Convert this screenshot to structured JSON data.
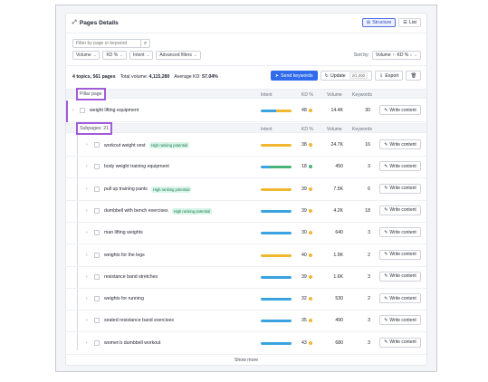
{
  "header": {
    "title": "Pages Details",
    "view_structure": "Structure",
    "view_list": "List"
  },
  "search": {
    "placeholder": "Filter by page or keyword"
  },
  "filters": [
    "Volume",
    "KD %",
    "Intent",
    "Advanced filters"
  ],
  "sort": {
    "label": "Sort by:",
    "value": "Volume ↑· KD % ↓"
  },
  "summary": {
    "topics": "4 topics, 561 pages",
    "volume_label": "Total volume:",
    "volume_value": "4,115,280",
    "kd_label": "Average KD:",
    "kd_value": "57.04%"
  },
  "actions": {
    "send": "Send keywords",
    "update": "Update",
    "update_limit": "2/1,000",
    "export": "Export"
  },
  "columns": {
    "intent": "Intent",
    "kd": "KD %",
    "volume": "Volume",
    "keywords": "Keywords"
  },
  "pillar_label": "Pillar page",
  "subpages_label": "Subpages: 21",
  "write_content": "Write content",
  "show_more": "Show more",
  "colors": {
    "accent": "#2f6bea",
    "highlight": "#a15ad9",
    "easy": "#4ab37a",
    "medium": "#f1b731",
    "info": "#3aa3e0"
  },
  "pillar": {
    "name": "weight lifting equipment",
    "kd": "48",
    "kd_color": "#f1b731",
    "volume": "14.4K",
    "keywords": "30",
    "intent": [
      {
        "c": "#3aa3e0",
        "w": 0.5
      },
      {
        "c": "#f1b731",
        "w": 0.5
      }
    ]
  },
  "subpages": [
    {
      "name": "workout weight vest",
      "badge": "High ranking potential",
      "kd": "38",
      "kd_color": "#f1b731",
      "volume": "24.7K",
      "keywords": "16",
      "intent": [
        {
          "c": "#f1b731",
          "w": 1
        }
      ]
    },
    {
      "name": "body weight training equipment",
      "badge": "",
      "kd": "18",
      "kd_color": "#4ab37a",
      "volume": "450",
      "keywords": "3",
      "intent": [
        {
          "c": "#3aa3e0",
          "w": 0.3
        },
        {
          "c": "#4ab37a",
          "w": 0.7
        }
      ]
    },
    {
      "name": "pull up training pants",
      "badge": "High ranking potential",
      "kd": "39",
      "kd_color": "#f1b731",
      "volume": "7.5K",
      "keywords": "6",
      "intent": [
        {
          "c": "#f1b731",
          "w": 1
        }
      ]
    },
    {
      "name": "dumbbell with bench exercises",
      "badge": "High ranking potential",
      "kd": "39",
      "kd_color": "#f1b731",
      "volume": "4.2K",
      "keywords": "18",
      "intent": [
        {
          "c": "#3aa3e0",
          "w": 1
        }
      ]
    },
    {
      "name": "man lifting weights",
      "badge": "",
      "kd": "30",
      "kd_color": "#f1b731",
      "volume": "640",
      "keywords": "3",
      "intent": [
        {
          "c": "#3aa3e0",
          "w": 1
        }
      ]
    },
    {
      "name": "weights for the legs",
      "badge": "",
      "kd": "40",
      "kd_color": "#f1b731",
      "volume": "1.9K",
      "keywords": "2",
      "intent": [
        {
          "c": "#f1b731",
          "w": 1
        }
      ]
    },
    {
      "name": "resistance band stretches",
      "badge": "",
      "kd": "39",
      "kd_color": "#f1b731",
      "volume": "1.6K",
      "keywords": "3",
      "intent": [
        {
          "c": "#3aa3e0",
          "w": 1
        }
      ]
    },
    {
      "name": "weights for running",
      "badge": "",
      "kd": "32",
      "kd_color": "#f1b731",
      "volume": "530",
      "keywords": "2",
      "intent": [
        {
          "c": "#3aa3e0",
          "w": 1
        }
      ]
    },
    {
      "name": "seated resistance band exercises",
      "badge": "",
      "kd": "35",
      "kd_color": "#f1b731",
      "volume": "490",
      "keywords": "3",
      "intent": [
        {
          "c": "#3aa3e0",
          "w": 1
        }
      ]
    },
    {
      "name": "women's dumbbell workout",
      "badge": "",
      "kd": "43",
      "kd_color": "#f1b731",
      "volume": "680",
      "keywords": "3",
      "intent": [
        {
          "c": "#3aa3e0",
          "w": 1
        }
      ]
    }
  ]
}
